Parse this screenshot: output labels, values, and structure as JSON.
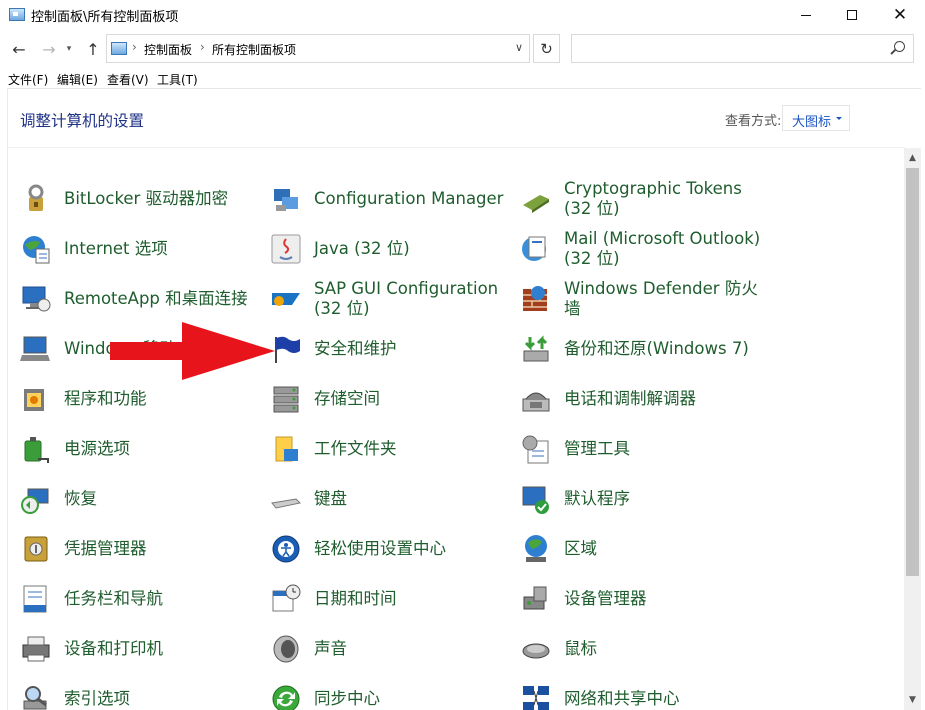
{
  "window": {
    "title": "控制面板\\所有控制面板项"
  },
  "address": {
    "crumbs": [
      "控制面板",
      "所有控制面板项"
    ],
    "search_placeholder": ""
  },
  "menu": [
    "文件(F)",
    "编辑(E)",
    "查看(V)",
    "工具(T)"
  ],
  "header": {
    "heading": "调整计算机的设置",
    "viewby_label": "查看方式:",
    "viewby_value": "大图标"
  },
  "items": [
    {
      "label": "BitLocker 驱动器加密",
      "icon": "bitlocker-icon"
    },
    {
      "label": "Configuration Manager",
      "icon": "configuration-manager-icon"
    },
    {
      "label": "Cryptographic Tokens (32 位)",
      "icon": "cryptographic-tokens-icon"
    },
    {
      "label": "Internet 选项",
      "icon": "internet-options-icon"
    },
    {
      "label": "Java (32 位)",
      "icon": "java-icon"
    },
    {
      "label": "Mail (Microsoft Outlook) (32 位)",
      "icon": "mail-icon"
    },
    {
      "label": "RemoteApp 和桌面连接",
      "icon": "remoteapp-icon"
    },
    {
      "label": "SAP GUI Configuration (32 位)",
      "icon": "sap-gui-icon"
    },
    {
      "label": "Windows Defender 防火墙",
      "icon": "firewall-icon"
    },
    {
      "label": "Windows 移动中心",
      "icon": "mobility-center-icon"
    },
    {
      "label": "安全和维护",
      "icon": "security-flag-icon"
    },
    {
      "label": "备份和还原(Windows 7)",
      "icon": "backup-restore-icon"
    },
    {
      "label": "程序和功能",
      "icon": "programs-features-icon"
    },
    {
      "label": "存储空间",
      "icon": "storage-spaces-icon"
    },
    {
      "label": "电话和调制解调器",
      "icon": "phone-modem-icon"
    },
    {
      "label": "电源选项",
      "icon": "power-options-icon"
    },
    {
      "label": "工作文件夹",
      "icon": "work-folders-icon"
    },
    {
      "label": "管理工具",
      "icon": "admin-tools-icon"
    },
    {
      "label": "恢复",
      "icon": "recovery-icon"
    },
    {
      "label": "键盘",
      "icon": "keyboard-icon"
    },
    {
      "label": "默认程序",
      "icon": "default-programs-icon"
    },
    {
      "label": "凭据管理器",
      "icon": "credential-manager-icon"
    },
    {
      "label": "轻松使用设置中心",
      "icon": "ease-of-access-icon"
    },
    {
      "label": "区域",
      "icon": "region-icon"
    },
    {
      "label": "任务栏和导航",
      "icon": "taskbar-icon"
    },
    {
      "label": "日期和时间",
      "icon": "date-time-icon"
    },
    {
      "label": "设备管理器",
      "icon": "device-manager-icon"
    },
    {
      "label": "设备和打印机",
      "icon": "devices-printers-icon"
    },
    {
      "label": "声音",
      "icon": "sound-icon"
    },
    {
      "label": "鼠标",
      "icon": "mouse-icon"
    },
    {
      "label": "索引选项",
      "icon": "indexing-options-icon"
    },
    {
      "label": "同步中心",
      "icon": "sync-center-icon"
    },
    {
      "label": "网络和共享中心",
      "icon": "network-sharing-icon"
    }
  ],
  "colors": {
    "heading": "#1e3287",
    "item_label": "#1f5d2e",
    "link_blue": "#1a55c0",
    "annotation_arrow": "#e8141b"
  }
}
